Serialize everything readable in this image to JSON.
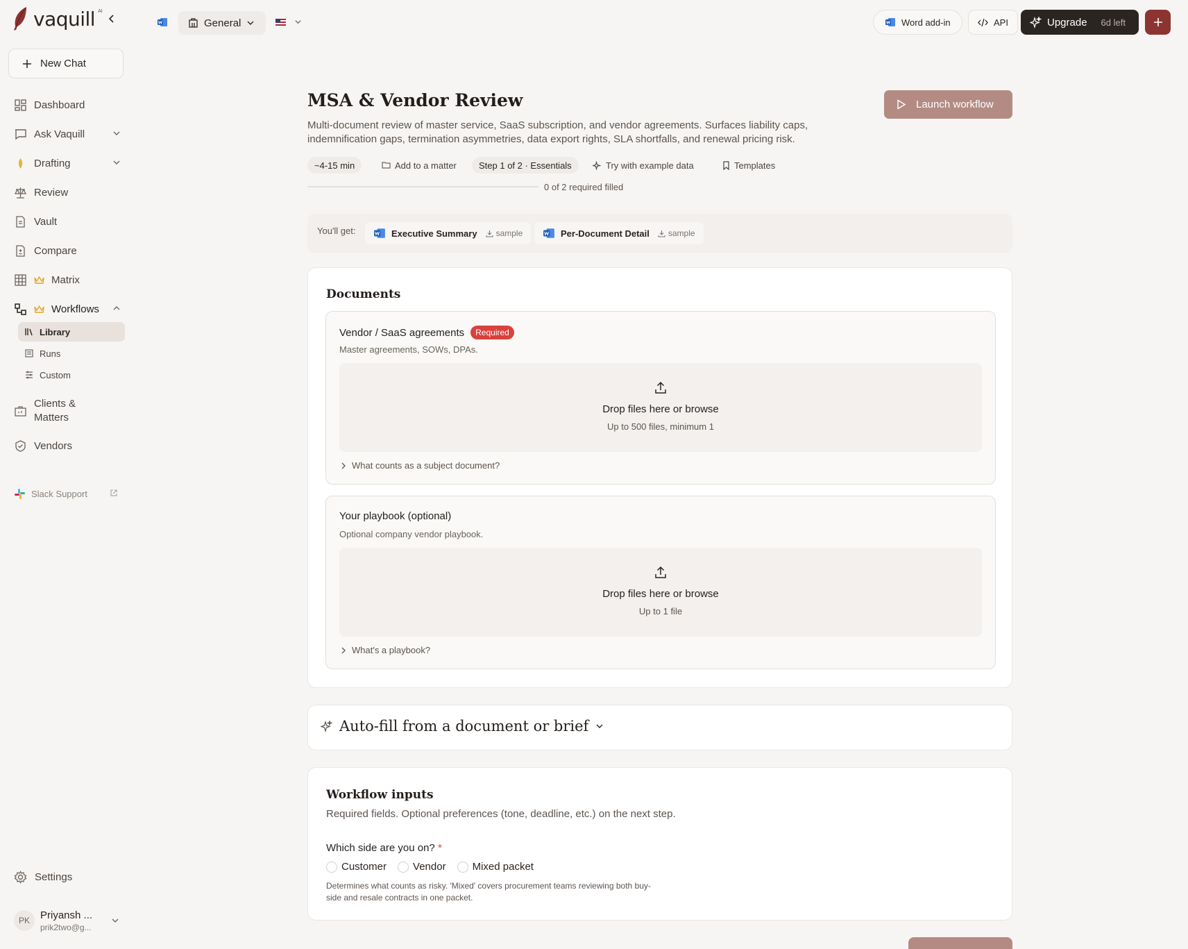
{
  "brand": {
    "name": "vaquill",
    "ai": "AI"
  },
  "sidebar": {
    "new_chat": "New Chat",
    "items": [
      {
        "label": "Dashboard"
      },
      {
        "label": "Ask Vaquill"
      },
      {
        "label": "Drafting"
      },
      {
        "label": "Review"
      },
      {
        "label": "Vault"
      },
      {
        "label": "Compare"
      },
      {
        "label": "Matrix"
      },
      {
        "label": "Workflows"
      },
      {
        "label": "Clients & Matters"
      },
      {
        "label": "Vendors"
      }
    ],
    "workflows_sub": [
      {
        "label": "Library",
        "active": true
      },
      {
        "label": "Runs"
      },
      {
        "label": "Custom"
      }
    ],
    "slack": "Slack Support",
    "settings": "Settings",
    "user": {
      "initials": "PK",
      "name": "Priyansh ...",
      "email": "prik2two@g..."
    }
  },
  "topbar": {
    "workspace": "General",
    "word_addin": "Word add-in",
    "api": "API",
    "upgrade": "Upgrade",
    "days_left": "6d left"
  },
  "page": {
    "title": "MSA & Vendor Review",
    "description": "Multi-document review of master service, SaaS subscription, and vendor agreements. Surfaces liability caps, indemnification gaps, termination asymmetries, data export rights, SLA shortfalls, and renewal pricing risk.",
    "launch": "Launch workflow",
    "chips": {
      "time": "~4-15 min",
      "matter": "Add to a matter",
      "step": "Step 1 of 2 · Essentials",
      "example": "Try with example data",
      "templates": "Templates"
    },
    "progress_text": "0 of 2 required filled",
    "progress_fraction": 0
  },
  "youll_get": {
    "label": "You'll get:",
    "items": [
      {
        "label": "Executive Summary",
        "sample": "sample"
      },
      {
        "label": "Per-Document Detail",
        "sample": "sample"
      }
    ]
  },
  "documents": {
    "title": "Documents",
    "groups": [
      {
        "title": "Vendor / SaaS agreements",
        "badge": "Required",
        "subtitle": "Master agreements, SOWs, DPAs.",
        "drop_main": "Drop files here or browse",
        "drop_sub": "Up to 500 files, minimum 1",
        "help": "What counts as a subject document?"
      },
      {
        "title": "Your playbook (optional)",
        "subtitle": "Optional company vendor playbook.",
        "drop_main": "Drop files here or browse",
        "drop_sub": "Up to 1 file",
        "help": "What's a playbook?"
      }
    ]
  },
  "autofill": {
    "title": "Auto-fill from a document or brief"
  },
  "workflow_inputs": {
    "title": "Workflow inputs",
    "subtitle": "Required fields. Optional preferences (tone, deadline, etc.) on the next step.",
    "question": "Which side are you on?",
    "required_mark": "*",
    "options": [
      "Customer",
      "Vendor",
      "Mixed packet"
    ],
    "note": "Determines what counts as risky. 'Mixed' covers procurement teams reviewing both buy-side and resale contracts in one packet."
  },
  "colors": {
    "accent": "#8c3432",
    "launch": "#b38b83",
    "required": "#d9413c",
    "crown": "#e0a626"
  }
}
